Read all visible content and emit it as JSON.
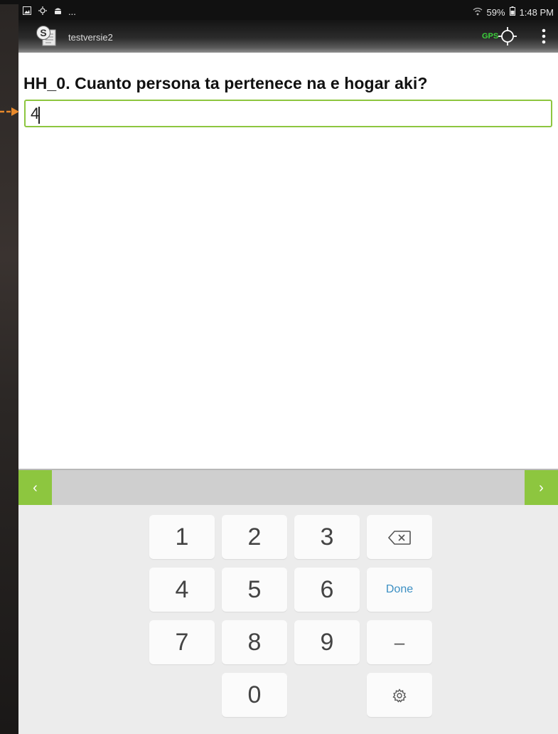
{
  "status_bar": {
    "left_icons": [
      "image-icon",
      "notification-icon",
      "android-icon",
      "more-dots"
    ],
    "more_text": "...",
    "battery": "59%",
    "time": "1:48 PM"
  },
  "app_bar": {
    "title": "testversie2",
    "gps_label": "GPS"
  },
  "question": {
    "text": "HH_0. Cuanto persona ta pertenece na e hogar aki?",
    "answer_value": "4"
  },
  "navigation": {
    "prev_symbol": "‹",
    "next_symbol": "›"
  },
  "keyboard": {
    "keys": [
      "1",
      "2",
      "3",
      "4",
      "5",
      "6",
      "7",
      "8",
      "9",
      "0"
    ],
    "done_label": "Done",
    "minus_label": "–"
  },
  "colors": {
    "accent_green": "#8dc63f",
    "gps_green": "#3bd13b",
    "done_blue": "#3b8fc3"
  }
}
